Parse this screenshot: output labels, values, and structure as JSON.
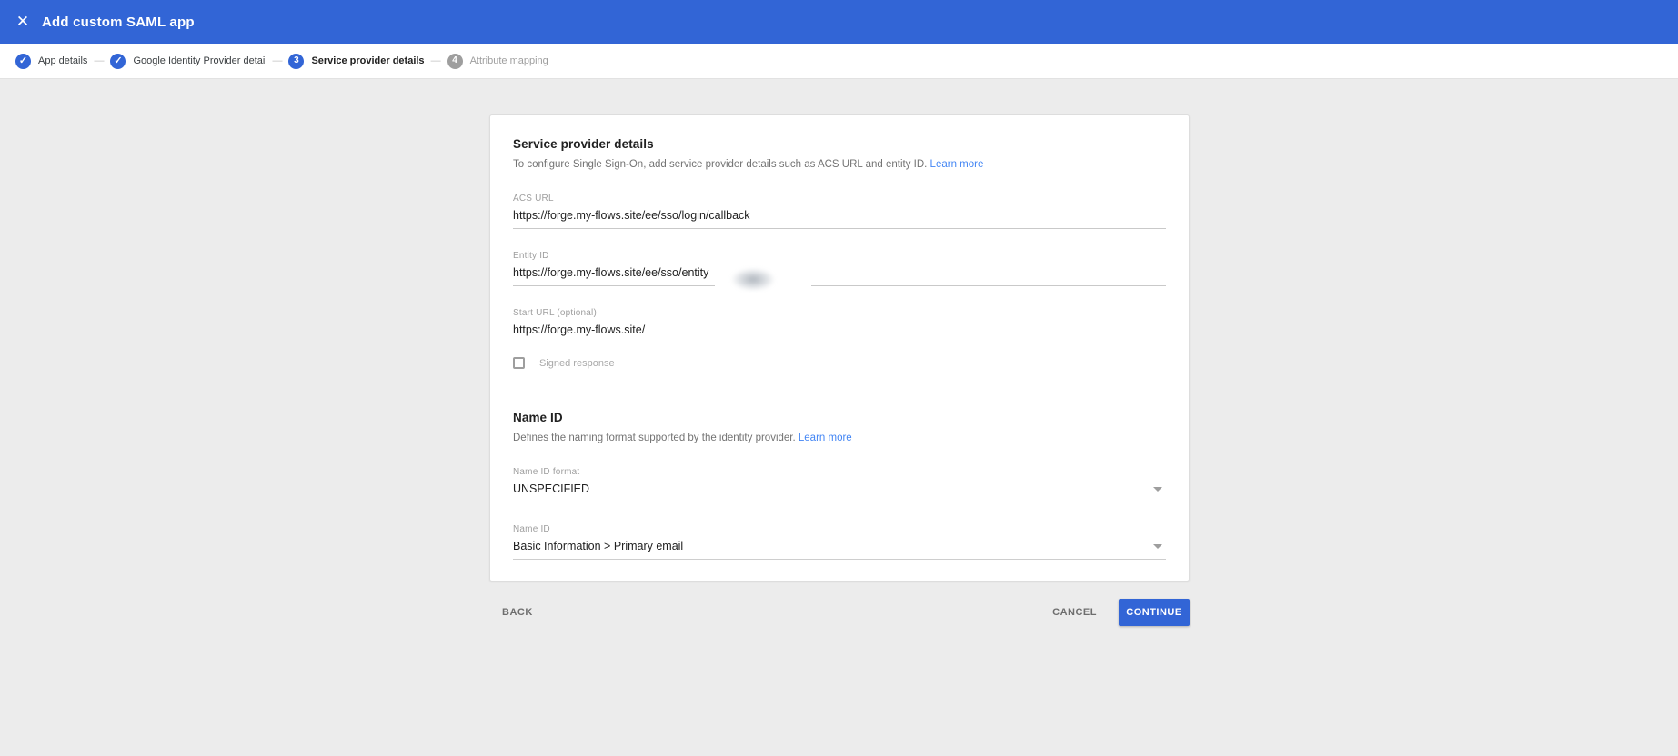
{
  "header": {
    "title": "Add custom SAML app"
  },
  "icons": {
    "close": "✕",
    "check": "✓",
    "dropdown": "▾"
  },
  "stepper": {
    "separator": "—",
    "steps": [
      {
        "label": "App details",
        "state": "completed"
      },
      {
        "label": "Google Identity Provider details",
        "state": "completed"
      },
      {
        "label": "Service provider details",
        "state": "active",
        "number": "3"
      },
      {
        "label": "Attribute mapping",
        "state": "upcoming",
        "number": "4"
      }
    ]
  },
  "card": {
    "section1": {
      "title": "Service provider details",
      "description": "To configure Single Sign-On, add service provider details such as ACS URL and entity ID.",
      "learn_more": "Learn more"
    },
    "fields": {
      "acs_url": {
        "label": "ACS URL",
        "value": "https://forge.my-flows.site/ee/sso/login/callback"
      },
      "entity_id": {
        "label": "Entity ID",
        "value": "https://forge.my-flows.site/ee/sso/entity"
      },
      "start_url": {
        "label": "Start URL (optional)",
        "value": "https://forge.my-flows.site/"
      },
      "signed_response": {
        "label": "Signed response",
        "checked": false
      }
    },
    "section2": {
      "title": "Name ID",
      "description": "Defines the naming format supported by the identity provider.",
      "learn_more": "Learn more"
    },
    "selects": {
      "name_id_format": {
        "label": "Name ID format",
        "value": "UNSPECIFIED"
      },
      "name_id": {
        "label": "Name ID",
        "value": "Basic Information > Primary email"
      }
    }
  },
  "footer": {
    "back": "BACK",
    "cancel": "CANCEL",
    "continue": "CONTINUE"
  },
  "colors": {
    "header_blue": "#3265d6",
    "continue_blue": "#3265d6",
    "link_blue": "#4285f4",
    "inactive_gray": "#9e9e9e",
    "body_background": "#ececec"
  }
}
